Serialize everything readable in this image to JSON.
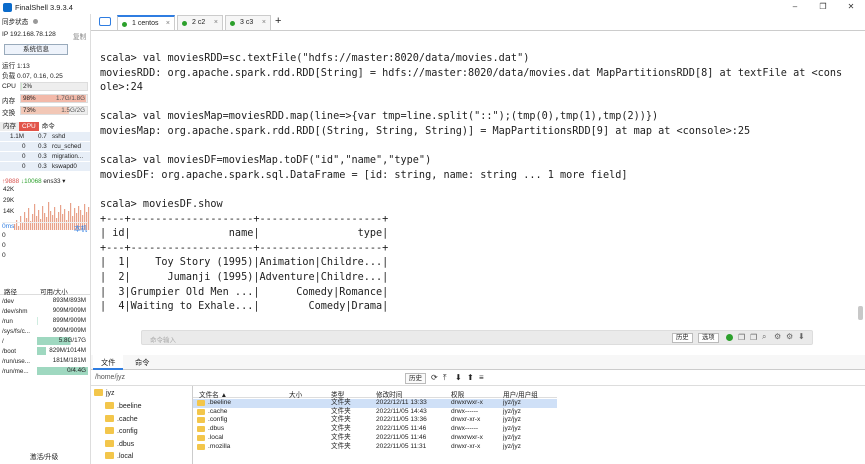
{
  "window": {
    "title": "FinalShell 3.9.3.4",
    "controls": [
      "–",
      "❐",
      "✕"
    ]
  },
  "sidebar": {
    "sync_status": "同步状态",
    "ip": "IP 192.168.78.128",
    "copy": "复制",
    "sys_info_button": "系统信息",
    "uptime": "运行 1:13",
    "load": "负载 0.07, 0.16, 0.25",
    "cpu": {
      "label": "CPU",
      "value": "2%",
      "percent": 2
    },
    "mem": {
      "label": "内存",
      "percent_text": "98%",
      "value": "1.7G/1.8G",
      "percent": 98
    },
    "swap": {
      "label": "交换",
      "percent_text": "73%",
      "value": "1.5G/2G",
      "percent": 73
    },
    "proc_tabs": [
      "内存",
      "CPU",
      "命令"
    ],
    "processes": [
      {
        "mem": "1.1M",
        "cpu": "0.7",
        "cmd": "sshd"
      },
      {
        "mem": "0",
        "cpu": "0.3",
        "cmd": "rcu_sched"
      },
      {
        "mem": "0",
        "cpu": "0.3",
        "cmd": "migration..."
      },
      {
        "mem": "0",
        "cpu": "0.3",
        "cmd": "kswapd0"
      }
    ],
    "net": {
      "up": "↑9888",
      "down": "↓10068",
      "iface": "ens33",
      "scale": [
        "42K",
        "29K",
        "14K"
      ]
    },
    "latency": {
      "label": "0ms",
      "host": "本机",
      "values": [
        "0",
        "0",
        "0"
      ]
    },
    "fs_header": {
      "path": "路径",
      "size": "可用/大小"
    },
    "filesystems": [
      {
        "path": "/dev",
        "size": "893M/893M",
        "usage": 0.0
      },
      {
        "path": "/dev/shm",
        "size": "909M/909M",
        "usage": 0.0
      },
      {
        "path": "/run",
        "size": "899M/909M",
        "usage": 0.01
      },
      {
        "path": "/sys/fs/c...",
        "size": "909M/909M",
        "usage": 0.0
      },
      {
        "path": "/",
        "size": "5.8G/17G",
        "usage": 0.66
      },
      {
        "path": "/boot",
        "size": "829M/1014M",
        "usage": 0.18
      },
      {
        "path": "/run/use...",
        "size": "181M/181M",
        "usage": 0.0
      },
      {
        "path": "/run/me...",
        "size": "0/4.4G",
        "usage": 1.0
      }
    ],
    "upgrade": "激活/升级"
  },
  "tabs": [
    {
      "label": "1 centos",
      "active": true
    },
    {
      "label": "2 c2",
      "active": false
    },
    {
      "label": "3 c3",
      "active": false
    }
  ],
  "terminal": {
    "lines": [
      "scala> val moviesRDD=sc.textFile(\"hdfs://master:8020/data/movies.dat\")",
      "moviesRDD: org.apache.spark.rdd.RDD[String] = hdfs://master:8020/data/movies.dat MapPartitionsRDD[8] at textFile at <cons",
      "ole>:24",
      "",
      "scala> val moviesMap=moviesRDD.map(line=>{var tmp=line.split(\"::\");(tmp(0),tmp(1),tmp(2))})",
      "moviesMap: org.apache.spark.rdd.RDD[(String, String, String)] = MapPartitionsRDD[9] at map at <console>:25",
      "",
      "scala> val moviesDF=moviesMap.toDF(\"id\",\"name\",\"type\")",
      "moviesDF: org.apache.spark.sql.DataFrame = [id: string, name: string ... 1 more field]",
      "",
      "scala> moviesDF.show",
      "+---+--------------------+--------------------+",
      "| id|                name|                type|",
      "+---+--------------------+--------------------+",
      "|  1|    Toy Story (1995)|Animation|Childre...|",
      "|  2|      Jumanji (1995)|Adventure|Childre...|",
      "|  3|Grumpier Old Men ...|      Comedy|Romance|",
      "|  4|Waiting to Exhale...|        Comedy|Drama|"
    ],
    "cmd_placeholder": "命令输入",
    "history_button": "历史",
    "options_button": "选项"
  },
  "bottom_tabs": [
    "文件",
    "命令"
  ],
  "file_panel": {
    "path": "/home/jyz",
    "history_button": "历史",
    "tree": [
      ".beeline",
      ".cache",
      ".config",
      ".dbus",
      ".local"
    ],
    "tree_root": "jyz",
    "columns": [
      "文件名 ▲",
      "大小",
      "类型",
      "修改时间",
      "权限",
      "用户/用户组"
    ],
    "files": [
      {
        "name": ".beeline",
        "size": "",
        "type": "文件夹",
        "mtime": "2022/12/11 13:33",
        "perm": "drwxrwxr-x",
        "owner": "jyz/jyz"
      },
      {
        "name": ".cache",
        "size": "",
        "type": "文件夹",
        "mtime": "2022/11/05 14:43",
        "perm": "drwx------",
        "owner": "jyz/jyz"
      },
      {
        "name": ".config",
        "size": "",
        "type": "文件夹",
        "mtime": "2022/11/05 13:36",
        "perm": "drwxr-xr-x",
        "owner": "jyz/jyz"
      },
      {
        "name": ".dbus",
        "size": "",
        "type": "文件夹",
        "mtime": "2022/11/05 11:46",
        "perm": "drwx------",
        "owner": "jyz/jyz"
      },
      {
        "name": ".local",
        "size": "",
        "type": "文件夹",
        "mtime": "2022/11/05 11:46",
        "perm": "drwxrwxr-x",
        "owner": "jyz/jyz"
      },
      {
        "name": ".mozilla",
        "size": "",
        "type": "文件夹",
        "mtime": "2022/11/05 11:31",
        "perm": "drwxr-xr-x",
        "owner": "jyz/jyz"
      }
    ]
  },
  "colors": {
    "accent": "#2f7de1",
    "mem_fill": "#f2b9a9",
    "swap_fill": "#f2c7b6",
    "disk_fill": "#9fd8c0",
    "green": "#2ca02c",
    "net_graph": "#e8a28a"
  }
}
